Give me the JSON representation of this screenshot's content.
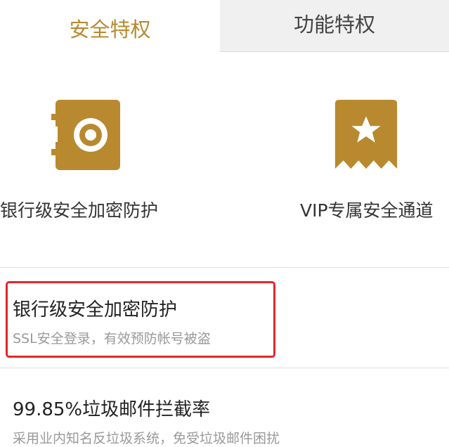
{
  "tabs": [
    {
      "label": "安全特权",
      "active": true
    },
    {
      "label": "功能特权",
      "active": false
    }
  ],
  "features": [
    {
      "icon": "safe-vault-icon",
      "label": "银行级安全加密防护"
    },
    {
      "icon": "star-ribbon-badge-icon",
      "label": "VIP专属安全通道"
    }
  ],
  "list": [
    {
      "title": "银行级安全加密防护",
      "desc": "SSL安全登录，有效预防帐号被盗",
      "highlighted": true
    },
    {
      "title": "99.85%垃圾邮件拦截率",
      "desc": "采用业内知名反垃圾系统，免受垃圾邮件困扰",
      "highlighted": false
    }
  ],
  "colors": {
    "accent": "#b8892f",
    "icon_gold": "#b8892f",
    "highlight_border": "#e0282a",
    "inactive_tab_bg": "#f0f0f0"
  }
}
